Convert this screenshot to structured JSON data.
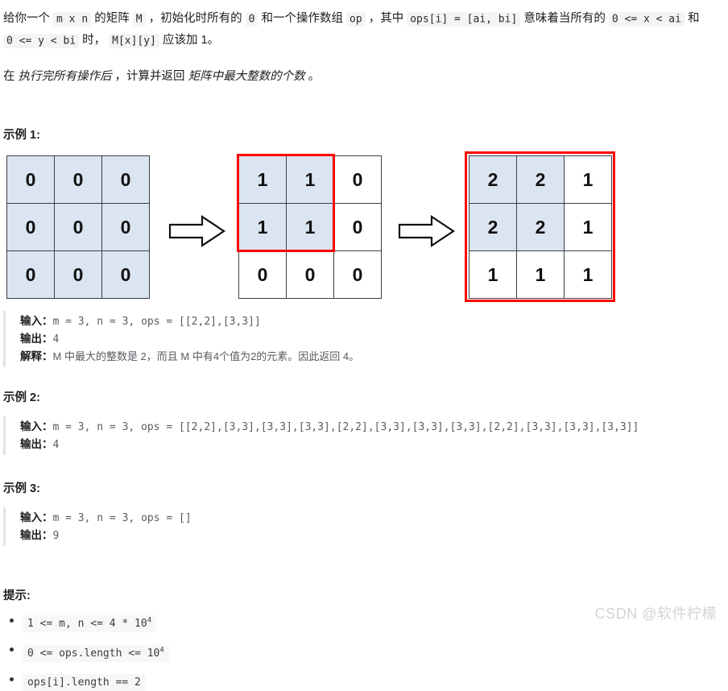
{
  "description": {
    "p1": {
      "t1": "给你一个 ",
      "c1": "m x n",
      "t2": " 的矩阵 ",
      "c2": "M",
      "t3": " ，初始化时所有的 ",
      "c3": "0",
      "t4": " 和一个操作数组 ",
      "c4": "op",
      "t5": " ，其中 ",
      "c5": "ops[i] = [ai, bi]",
      "t6": " 意味着当所有的 ",
      "c6": "0 <= x < ai",
      "t7": " 和 ",
      "c7": "0 <= y < bi",
      "t8": " 时， ",
      "c8": "M[x][y]",
      "t9": " 应该加 1。"
    },
    "p2": {
      "t1": "在 ",
      "i1": "执行完所有操作后",
      "t2": " ，计算并返回 ",
      "i2": "矩阵中最大整数的个数",
      "t3": " 。"
    }
  },
  "figure": {
    "matrix1": {
      "rows": [
        [
          "0",
          "0",
          "0"
        ],
        [
          "0",
          "0",
          "0"
        ],
        [
          "0",
          "0",
          "0"
        ]
      ],
      "fills": [
        [
          "blue",
          "blue",
          "blue"
        ],
        [
          "blue",
          "blue",
          "blue"
        ],
        [
          "blue",
          "blue",
          "blue"
        ]
      ]
    },
    "matrix2": {
      "rows": [
        [
          "1",
          "1",
          "0"
        ],
        [
          "1",
          "1",
          "0"
        ],
        [
          "0",
          "0",
          "0"
        ]
      ],
      "fills": [
        [
          "blue",
          "blue",
          "white"
        ],
        [
          "blue",
          "blue",
          "white"
        ],
        [
          "white",
          "white",
          "white"
        ]
      ]
    },
    "matrix3": {
      "rows": [
        [
          "2",
          "2",
          "1"
        ],
        [
          "2",
          "2",
          "1"
        ],
        [
          "1",
          "1",
          "1"
        ]
      ],
      "fills": [
        [
          "blue",
          "blue",
          "white"
        ],
        [
          "blue",
          "blue",
          "white"
        ],
        [
          "white",
          "white",
          "white"
        ]
      ]
    },
    "highlight_color": "#ff0000",
    "cell_blue": "#dbe5f1"
  },
  "examples": [
    {
      "title": "示例 1:",
      "input_label": "输入：",
      "input_value": "m = 3, n = 3, ops = [[2,2],[3,3]]",
      "output_label": "输出：",
      "output_value": "4",
      "explain_label": "解释：",
      "explain_value": "M 中最大的整数是 2，而且 M 中有4个值为2的元素。因此返回 4。"
    },
    {
      "title": "示例 2:",
      "input_label": "输入：",
      "input_value": "m = 3, n = 3, ops = [[2,2],[3,3],[3,3],[3,3],[2,2],[3,3],[3,3],[3,3],[2,2],[3,3],[3,3],[3,3]]",
      "output_label": "输出：",
      "output_value": "4",
      "explain_label": "",
      "explain_value": ""
    },
    {
      "title": "示例 3:",
      "input_label": "输入：",
      "input_value": "m = 3, n = 3, ops = []",
      "output_label": "输出：",
      "output_value": "9",
      "explain_label": "",
      "explain_value": ""
    }
  ],
  "hints": {
    "title": "提示:",
    "items": [
      {
        "text": "1 <= m, n <= 4 * 10",
        "sup": "4"
      },
      {
        "text": "0 <= ops.length <= 10",
        "sup": "4"
      },
      {
        "text": "ops[i].length == 2",
        "sup": ""
      }
    ]
  },
  "watermark": "CSDN @软件柠檬"
}
